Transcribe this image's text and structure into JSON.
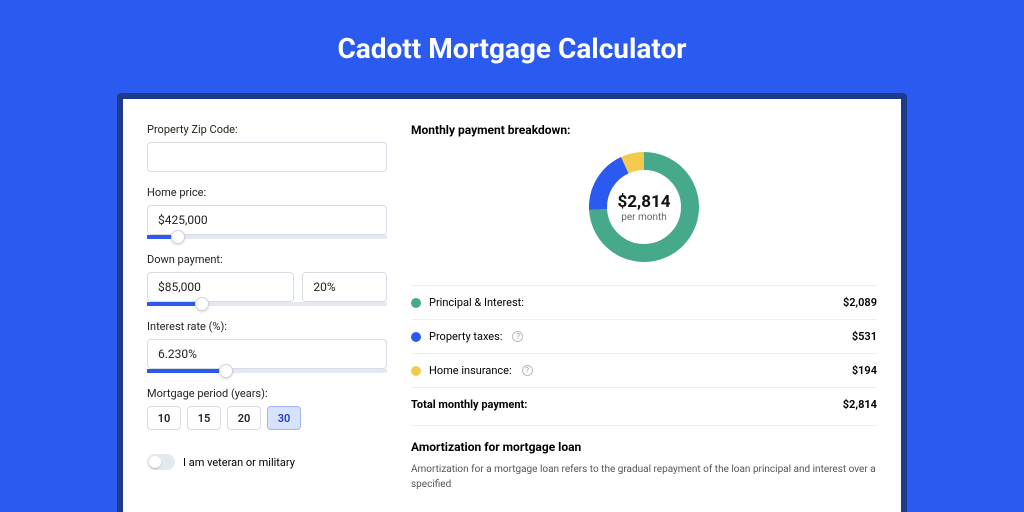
{
  "title": "Cadott Mortgage Calculator",
  "form": {
    "zip_label": "Property Zip Code:",
    "zip_value": "",
    "home_price_label": "Home price:",
    "home_price_value": "$425,000",
    "down_payment_label": "Down payment:",
    "down_payment_amount": "$85,000",
    "down_payment_pct": "20%",
    "interest_label": "Interest rate (%):",
    "interest_value": "6.230%",
    "period_label": "Mortgage period (years):",
    "periods": [
      "10",
      "15",
      "20",
      "30"
    ],
    "period_active_index": 3,
    "veteran_label": "I am veteran or military"
  },
  "breakdown": {
    "title": "Monthly payment breakdown:",
    "total_amount": "$2,814",
    "per_month": "per month",
    "items": [
      {
        "label": "Principal & Interest:",
        "value": "$2,089",
        "color": "#47a98c",
        "pct": 74
      },
      {
        "label": "Property taxes:",
        "value": "$531",
        "color": "#2a5af0",
        "pct": 19,
        "info": true
      },
      {
        "label": "Home insurance:",
        "value": "$194",
        "color": "#f3c94e",
        "pct": 7,
        "info": true
      }
    ],
    "total_label": "Total monthly payment:",
    "total_value": "$2,814"
  },
  "amortization": {
    "heading": "Amortization for mortgage loan",
    "body": "Amortization for a mortgage loan refers to the gradual repayment of the loan principal and interest over a specified"
  },
  "chart_data": {
    "type": "pie",
    "title": "Monthly payment breakdown",
    "series": [
      {
        "name": "Principal & Interest",
        "value": 2089
      },
      {
        "name": "Property taxes",
        "value": 531
      },
      {
        "name": "Home insurance",
        "value": 194
      }
    ],
    "total": 2814,
    "unit": "USD/month"
  }
}
